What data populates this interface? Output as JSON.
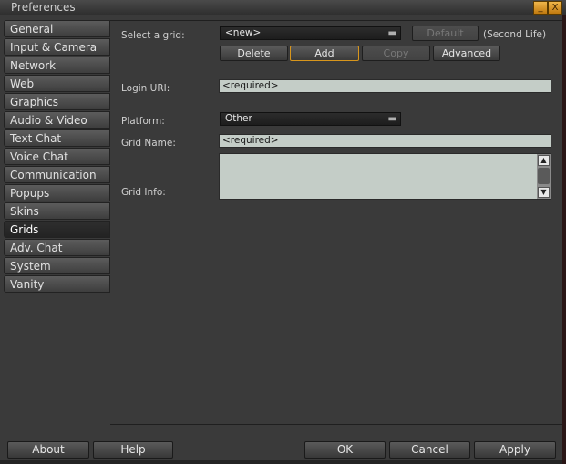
{
  "window": {
    "title": "Preferences",
    "minimize_glyph": "_",
    "close_glyph": "X"
  },
  "sidebar": {
    "items": [
      {
        "label": "General"
      },
      {
        "label": "Input & Camera"
      },
      {
        "label": "Network"
      },
      {
        "label": "Web"
      },
      {
        "label": "Graphics"
      },
      {
        "label": "Audio & Video"
      },
      {
        "label": "Text Chat"
      },
      {
        "label": "Voice Chat"
      },
      {
        "label": "Communication"
      },
      {
        "label": "Popups"
      },
      {
        "label": "Skins"
      },
      {
        "label": "Grids"
      },
      {
        "label": "Adv. Chat"
      },
      {
        "label": "System"
      },
      {
        "label": "Vanity"
      }
    ],
    "active": "Grids"
  },
  "grids": {
    "select_label": "Select a grid:",
    "select_value": "<new>",
    "default_button": "Default",
    "default_note": "(Second Life)",
    "delete_button": "Delete",
    "add_button": "Add",
    "copy_button": "Copy",
    "advanced_button": "Advanced",
    "login_uri_label": "Login URI:",
    "login_uri_value": "<required>",
    "platform_label": "Platform:",
    "platform_value": "Other",
    "grid_name_label": "Grid Name:",
    "grid_name_value": "<required>",
    "grid_info_label": "Grid Info:",
    "grid_info_value": ""
  },
  "footer": {
    "about": "About",
    "help": "Help",
    "ok": "OK",
    "cancel": "Cancel",
    "apply": "Apply"
  },
  "colors": {
    "focus_border": "#d8961c",
    "input_bg": "#c4cdc7",
    "title_button": "#e0a030"
  }
}
